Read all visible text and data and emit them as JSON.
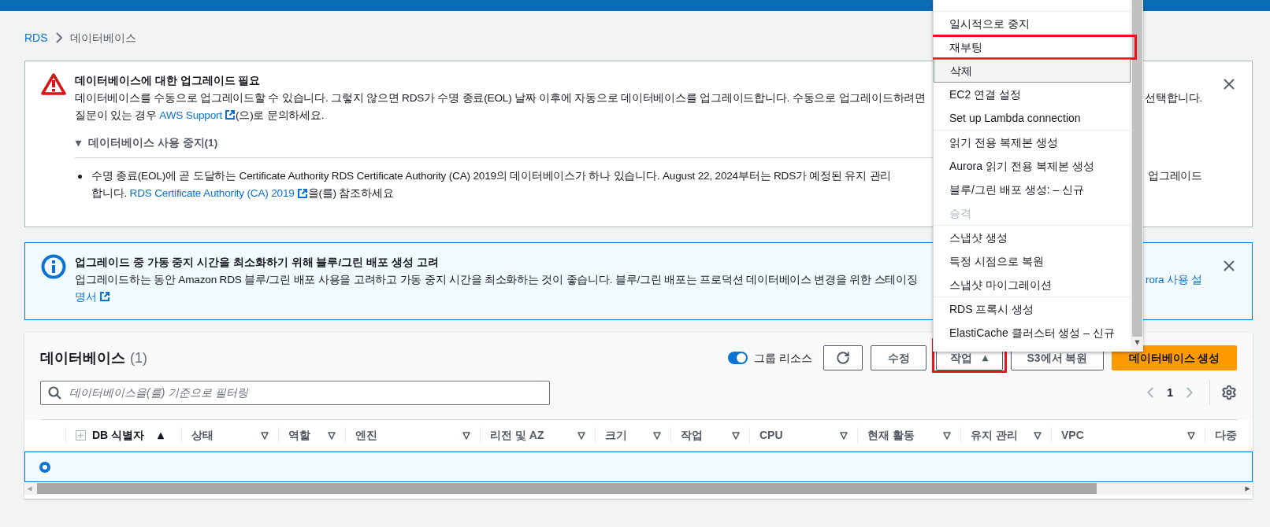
{
  "breadcrumb": [
    {
      "label": "RDS",
      "kind": "link"
    },
    {
      "label": "데이터베이스",
      "kind": "text"
    }
  ],
  "upgrade_alert": {
    "kind": "warning",
    "title": "데이터베이스에 대한 업그레이드 필요",
    "body": [
      {
        "left": [
          {
            "kind": "text",
            "text": "데이터베이스를 수동으로 업그레이드할 수 있습니다. 그렇지 않으면 RDS가 수명 종료(EOL) 날짜 이후에 자동으로 데이터베이스를 업그레이드합니다. 수동으로 업그레이드하려면"
          }
        ],
        "right": [
          {
            "kind": "text",
            "text": "선택합니다."
          }
        ]
      },
      {
        "left": [
          {
            "kind": "text",
            "text": "질문이 있는 경우 "
          },
          {
            "kind": "external_link",
            "text": "AWS Support"
          },
          {
            "kind": "text",
            "text": "(으)로 문의하세요."
          }
        ]
      }
    ],
    "section": {
      "label": "데이터베이스 사용 중지(1)",
      "expanded": true
    },
    "bullet": [
      {
        "left": [
          {
            "kind": "text",
            "text": "수명 종료(EOL)에 곧 도달하는 Certificate Authority RDS Certificate Authority (CA) 2019의 데이터베이스가 하나 있습니다. August 22, 2024부터는 RDS가 예정된 유지 관리"
          }
        ],
        "right": [
          {
            "kind": "text",
            "text": "업그레이드"
          }
        ]
      },
      {
        "left": [
          {
            "kind": "text",
            "text": "합니다. "
          },
          {
            "kind": "external_link",
            "text": "RDS Certificate Authority (CA) 2019"
          },
          {
            "kind": "text",
            "text": "을(를) 참조하세요"
          }
        ]
      }
    ]
  },
  "info_alert": {
    "kind": "info",
    "title": "업그레이드 중 가동 중지 시간을 최소화하기 위해 블루/그린 배포 생성 고려",
    "body": [
      {
        "left": [
          {
            "kind": "text",
            "text": "업그레이드하는 동안 Amazon RDS 블루/그린 배포 사용을 고려하고 가동 중지 시간을 최소화하는 것이 좋습니다. 블루/그린 배포는 프로덕션 데이터베이스 변경을 위한 스테이징"
          }
        ],
        "right": [
          {
            "kind": "link",
            "text": "rora 사용 설"
          }
        ]
      },
      {
        "left": [
          {
            "kind": "external_link",
            "text": "명서"
          }
        ]
      }
    ]
  },
  "databases": {
    "title": "데이터베이스",
    "count": "(1)",
    "group_toggle": {
      "label": "그룹 리소스",
      "on": true
    },
    "buttons": [
      {
        "label": "수정",
        "kind": "default",
        "annotated": false
      },
      {
        "label": "작업",
        "kind": "dropdown",
        "expanded": true,
        "annotated": true
      },
      {
        "label": "S3에서 복원",
        "kind": "default",
        "annotated": false
      },
      {
        "label": "데이터베이스 생성",
        "kind": "primary",
        "annotated": false
      }
    ],
    "search": {
      "placeholder": "데이터베이스을(를) 기준으로 필터링"
    },
    "pagination": {
      "page": "1"
    },
    "columns": [
      {
        "label": "DB 식별자",
        "kind": "sorted"
      },
      {
        "label": "상태",
        "kind": "sortable"
      },
      {
        "label": "역할",
        "kind": "sortable"
      },
      {
        "label": "엔진",
        "kind": "sortable"
      },
      {
        "label": "리전 및 AZ",
        "kind": "sortable"
      },
      {
        "label": "크기",
        "kind": "sortable"
      },
      {
        "label": "작업",
        "kind": "sortable"
      },
      {
        "label": "CPU",
        "kind": "sortable"
      },
      {
        "label": "현재 활동",
        "kind": "sortable"
      },
      {
        "label": "유지 관리",
        "kind": "sortable"
      },
      {
        "label": "VPC",
        "kind": "sortable"
      },
      {
        "label": "다중",
        "kind": "plain"
      }
    ],
    "rows": [
      {
        "selected": true
      }
    ]
  },
  "actions_menu": {
    "groups": [
      [
        {
          "label": "일시적으로 중지",
          "disabled": false,
          "highlighted": false,
          "annotated": false
        },
        {
          "label": "재부팅",
          "disabled": false,
          "highlighted": false,
          "annotated": true
        },
        {
          "label": "삭제",
          "disabled": false,
          "highlighted": true,
          "annotated": false
        },
        {
          "label": "EC2 연결 설정",
          "disabled": false,
          "highlighted": false,
          "annotated": false
        },
        {
          "label": "Set up Lambda connection",
          "disabled": false,
          "highlighted": false,
          "annotated": false
        }
      ],
      [
        {
          "label": "읽기 전용 복제본 생성",
          "disabled": false,
          "highlighted": false,
          "annotated": false
        },
        {
          "label": "Aurora 읽기 전용 복제본 생성",
          "disabled": false,
          "highlighted": false,
          "annotated": false
        },
        {
          "label": "블루/그린 배포 생성: – 신규",
          "disabled": false,
          "highlighted": false,
          "annotated": false
        },
        {
          "label": "승격",
          "disabled": true,
          "highlighted": false,
          "annotated": false
        }
      ],
      [
        {
          "label": "스냅샷 생성",
          "disabled": false,
          "highlighted": false,
          "annotated": false
        },
        {
          "label": "특정 시점으로 복원",
          "disabled": false,
          "highlighted": false,
          "annotated": false
        },
        {
          "label": "스냅샷 마이그레이션",
          "disabled": false,
          "highlighted": false,
          "annotated": false
        }
      ],
      [
        {
          "label": "RDS 프록시 생성",
          "disabled": false,
          "highlighted": false,
          "annotated": false
        },
        {
          "label": "ElastiCache 클러스터 생성 – 신규",
          "disabled": false,
          "highlighted": false,
          "annotated": false
        }
      ]
    ]
  }
}
